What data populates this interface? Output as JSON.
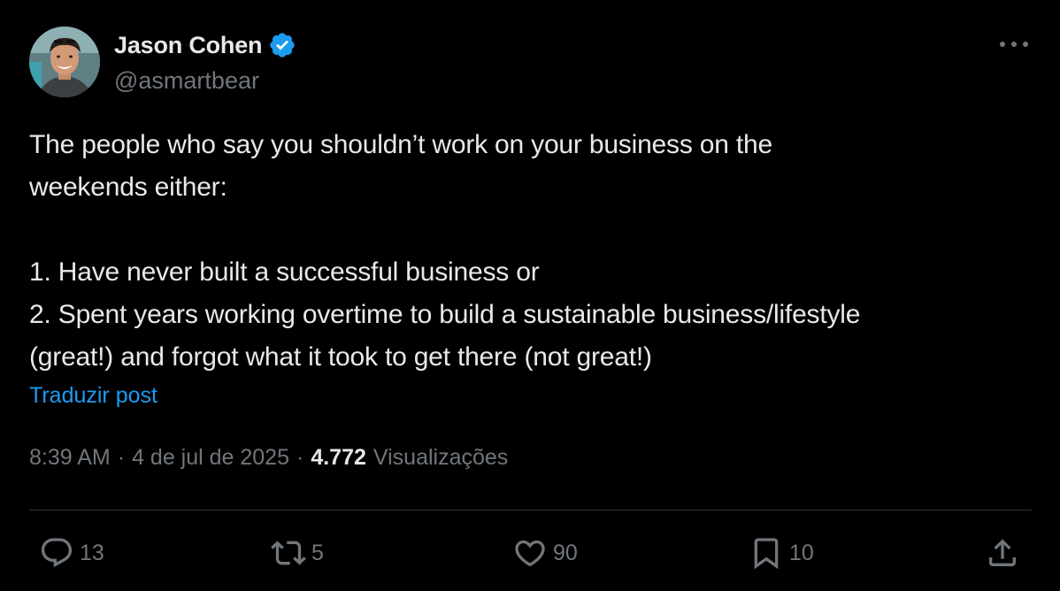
{
  "author": {
    "display_name": "Jason Cohen",
    "handle": "@asmartbear",
    "verified": true
  },
  "post": {
    "lines": [
      "The people who say you shouldn’t work on your business on the",
      "weekends either:",
      "",
      "1. Have never built a successful business or",
      "2. Spent years working overtime to build a sustainable business/lifestyle",
      "(great!) and forgot what it took to get there (not great!)"
    ],
    "translate_label": "Traduzir post"
  },
  "meta": {
    "time": "8:39 AM",
    "separator": "·",
    "date": "4 de jul de 2025",
    "views_count": "4.772",
    "views_label": "Visualizações"
  },
  "actions": {
    "replies": "13",
    "reposts": "5",
    "likes": "90",
    "bookmarks": "10"
  },
  "icons": {
    "verified": "verified-badge-icon",
    "more": "more-icon",
    "reply": "reply-icon",
    "repost": "repost-icon",
    "like": "heart-icon",
    "bookmark": "bookmark-icon",
    "share": "share-icon"
  },
  "colors": {
    "background": "#000000",
    "text_primary": "#e7e9ea",
    "text_secondary": "#71767b",
    "accent": "#1d9bf0",
    "divider": "#2f3336"
  }
}
